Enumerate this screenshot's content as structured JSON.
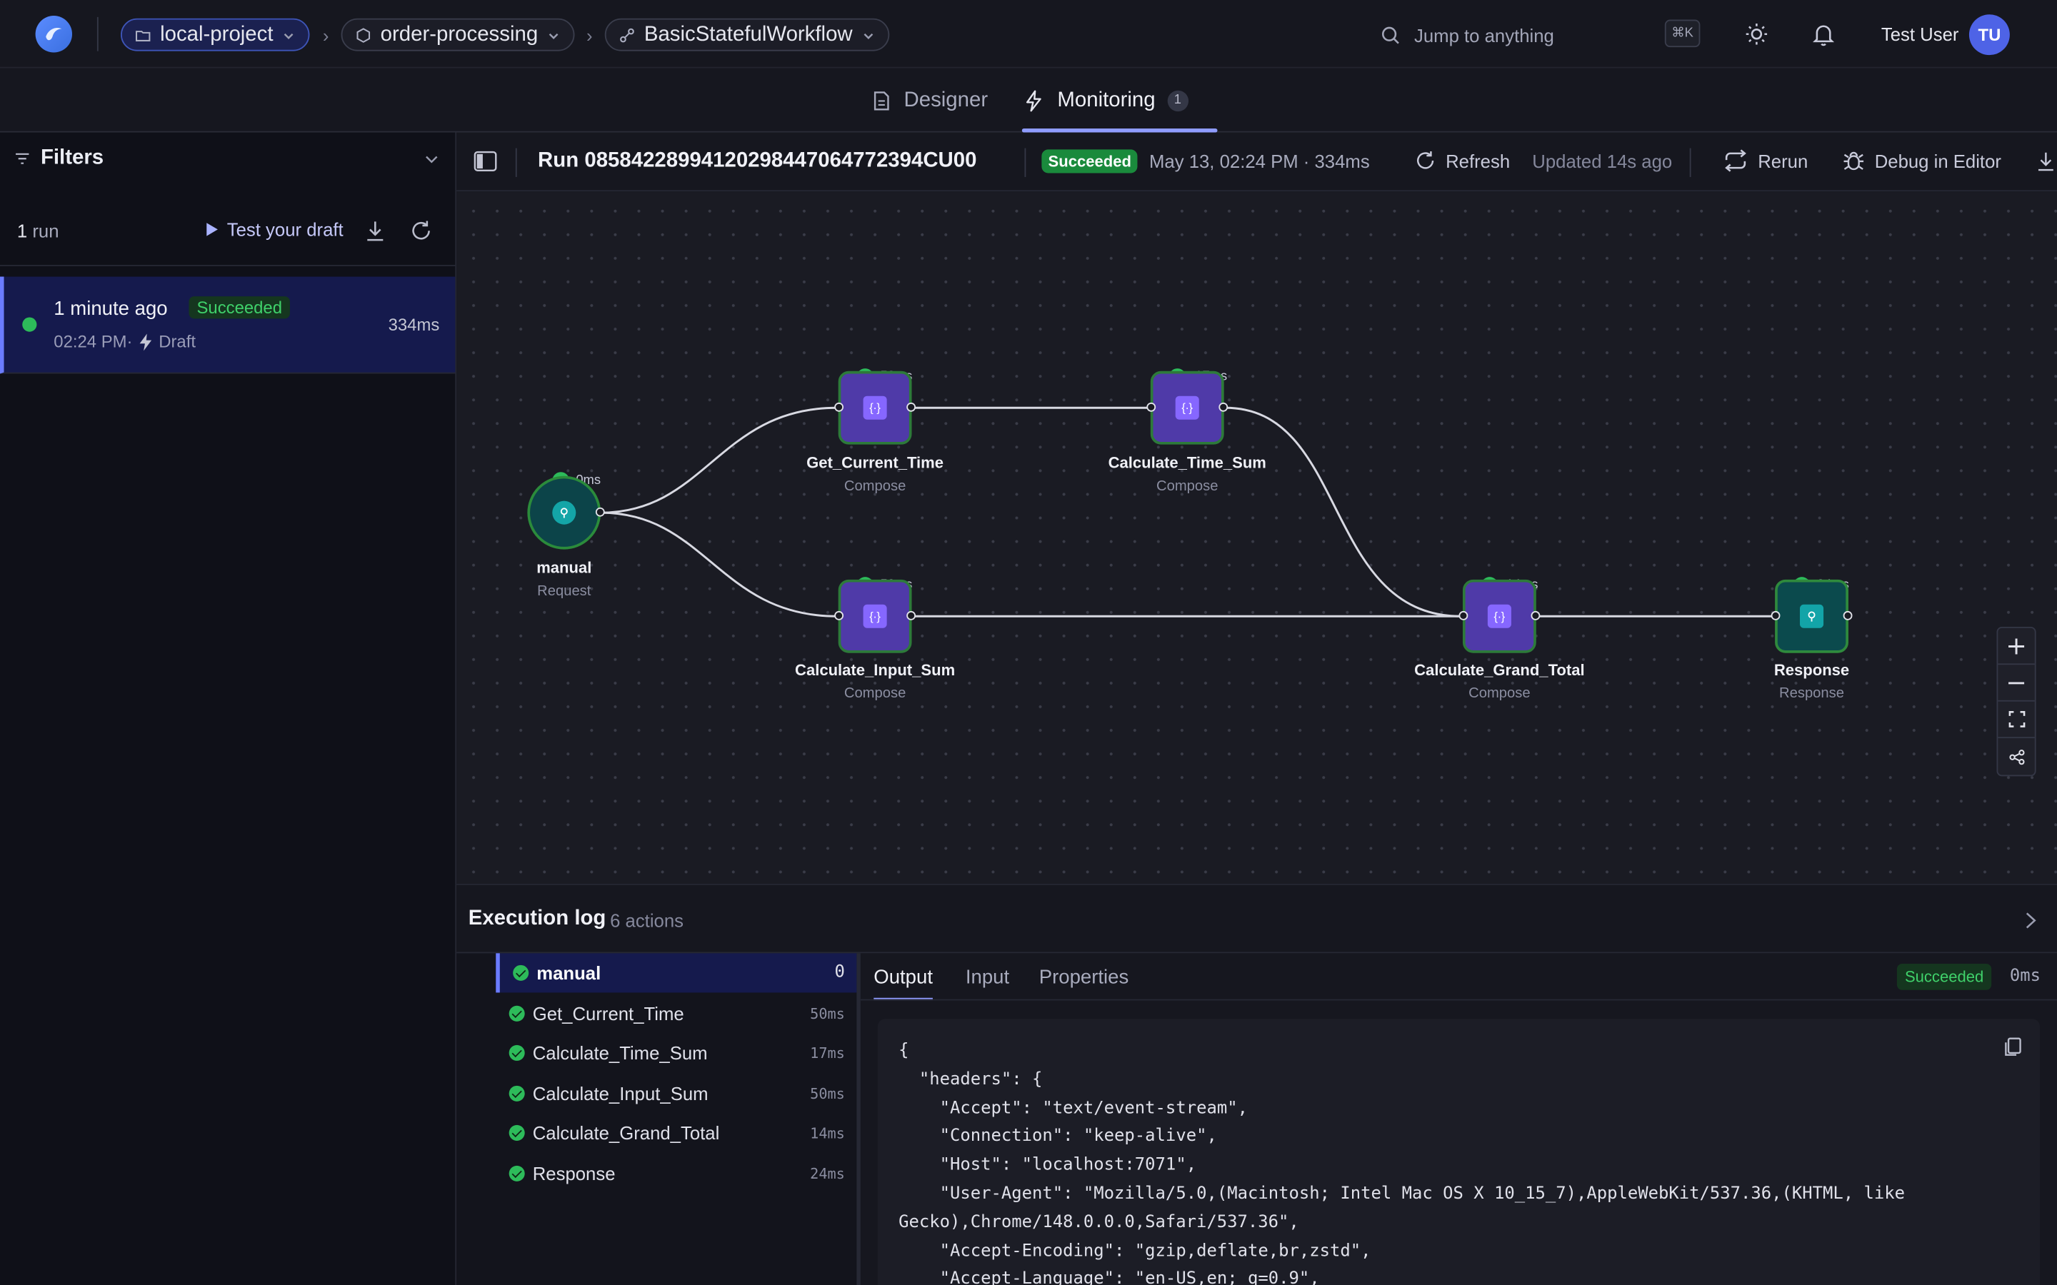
{
  "topbar": {
    "breadcrumbs": [
      {
        "label": "local-project",
        "icon": "folder-icon"
      },
      {
        "label": "order-processing",
        "icon": "cube-icon"
      },
      {
        "label": "BasicStatefulWorkflow",
        "icon": "workflow-icon"
      }
    ],
    "search_placeholder": "Jump to anything",
    "shortcut": "⌘K",
    "user_name": "Test User",
    "user_initials": "TU"
  },
  "tabs": [
    {
      "label": "Designer",
      "icon": "file-icon"
    },
    {
      "label": "Monitoring",
      "icon": "bolt-icon",
      "badge": "1"
    }
  ],
  "filters": {
    "title": "Filters",
    "run_count": "1",
    "run_count_label": "run",
    "test_draft_label": "Test your draft",
    "runs": [
      {
        "when": "1 minute ago",
        "status": "Succeeded",
        "time": "02:24 PM·",
        "kind": "Draft",
        "duration": "334ms"
      }
    ]
  },
  "run_header": {
    "title": "Run 08584228994120298447064772394CU00",
    "status": "Succeeded",
    "date": "May 13, 02:24 PM  ·  334ms",
    "refresh_label": "Refresh",
    "updated": "Updated 14s ago",
    "rerun_label": "Rerun",
    "debug_label": "Debug in Editor"
  },
  "workflow": {
    "nodes": [
      {
        "id": "manual",
        "name": "manual",
        "type": "Request",
        "time": "0ms"
      },
      {
        "id": "get_current_time",
        "name": "Get_Current_Time",
        "type": "Compose",
        "time": "50ms"
      },
      {
        "id": "calculate_time_sum",
        "name": "Calculate_Time_Sum",
        "type": "Compose",
        "time": "17ms"
      },
      {
        "id": "calculate_input_sum",
        "name": "Calculate_Input_Sum",
        "type": "Compose",
        "time": "50ms"
      },
      {
        "id": "calculate_grand_total",
        "name": "Calculate_Grand_Total",
        "type": "Compose",
        "time": "14ms"
      },
      {
        "id": "response",
        "name": "Response",
        "type": "Response",
        "time": "24ms"
      }
    ]
  },
  "execution_log": {
    "title": "Execution log",
    "count": "6 actions",
    "actions": [
      {
        "name": "manual",
        "duration": "0",
        "selected": true
      },
      {
        "name": "Get_Current_Time",
        "duration": "50ms"
      },
      {
        "name": "Calculate_Time_Sum",
        "duration": "17ms"
      },
      {
        "name": "Calculate_Input_Sum",
        "duration": "50ms"
      },
      {
        "name": "Calculate_Grand_Total",
        "duration": "14ms"
      },
      {
        "name": "Response",
        "duration": "24ms"
      }
    ],
    "detail_tabs": [
      "Output",
      "Input",
      "Properties"
    ],
    "detail_status": "Succeeded",
    "detail_duration": "0ms",
    "output_code": "{\n  \"headers\": {\n    \"Accept\": \"text/event-stream\",\n    \"Connection\": \"keep-alive\",\n    \"Host\": \"localhost:7071\",\n    \"User-Agent\": \"Mozilla/5.0,(Macintosh; Intel Mac OS X 10_15_7),AppleWebKit/537.36,(KHTML, like Gecko),Chrome/148.0.0.0,Safari/537.36\",\n    \"Accept-Encoding\": \"gzip,deflate,br,zstd\",\n    \"Accept-Language\": \"en-US,en; q=0.9\","
  },
  "colors": {
    "accent": "#6b7cff",
    "success": "#2dbb5a",
    "compose_node": "#4f3aa8",
    "trigger_node": "#0c4449"
  }
}
